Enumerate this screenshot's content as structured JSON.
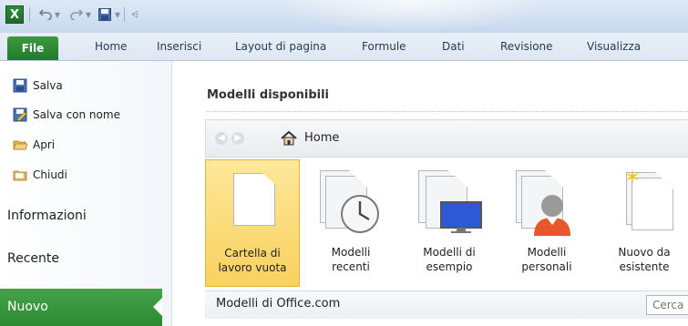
{
  "quick_access": {
    "app_icon": "X",
    "icons": [
      "excel-app-icon",
      "undo-icon",
      "redo-icon",
      "save-icon",
      "customize-icon"
    ]
  },
  "ribbon_tabs": [
    {
      "label": "File",
      "active": true
    },
    {
      "label": "Home"
    },
    {
      "label": "Inserisci"
    },
    {
      "label": "Layout di pagina"
    },
    {
      "label": "Formule"
    },
    {
      "label": "Dati"
    },
    {
      "label": "Revisione"
    },
    {
      "label": "Visualizza"
    }
  ],
  "nav": {
    "commands": [
      {
        "label": "Salva",
        "icon": "save-icon"
      },
      {
        "label": "Salva con nome",
        "icon": "save-as-icon"
      },
      {
        "label": "Apri",
        "icon": "open-folder-icon"
      },
      {
        "label": "Chiudi",
        "icon": "close-folder-icon"
      }
    ],
    "sections": [
      "Informazioni",
      "Recente"
    ],
    "active": "Nuovo"
  },
  "main": {
    "heading": "Modelli disponibili",
    "breadcrumb": "Home",
    "tiles": [
      {
        "line1": "Cartella di",
        "line2": "lavoro vuota",
        "icon": "blank-workbook-icon",
        "selected": true
      },
      {
        "line1": "Modelli",
        "line2": "recenti",
        "icon": "recent-templates-icon"
      },
      {
        "line1": "Modelli di",
        "line2": "esempio",
        "icon": "sample-templates-icon"
      },
      {
        "line1": "Modelli",
        "line2": "personali",
        "icon": "personal-templates-icon"
      },
      {
        "line1": "Nuovo da",
        "line2": "esistente",
        "icon": "new-from-existing-icon"
      }
    ],
    "office_section": "Modelli di Office.com",
    "search_placeholder": "Cerca"
  },
  "colors": {
    "file_tab": "#2a8a32",
    "selected_tile": "#fbdd7a",
    "ribbon": "#dde7f3"
  }
}
